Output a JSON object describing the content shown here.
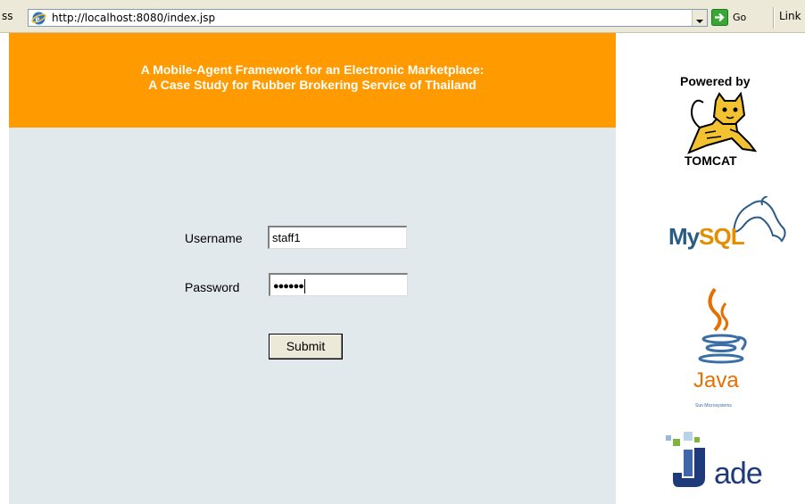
{
  "browser": {
    "address_label": "ss",
    "url": "http://localhost:8080/index.jsp",
    "go_label": "Go",
    "links_label": "Link"
  },
  "header": {
    "title_line1": "A Mobile-Agent Framework for an Electronic Marketplace:",
    "title_line2": "A Case Study for Rubber Brokering Service of Thailand"
  },
  "form": {
    "username_label": "Username",
    "username_value": "staff1",
    "password_label": "Password",
    "password_masked": "●●●●●●",
    "submit_label": "Submit"
  },
  "logos": {
    "powered_by": "Powered by",
    "tomcat": "TOMCAT",
    "mysql_my": "My",
    "mysql_sql": "SQL",
    "java": "Java",
    "sun": "Sun Microsystems",
    "jade": "ade"
  },
  "colors": {
    "header_bg": "#ff9a00",
    "main_bg": "#e2e9ec",
    "mysql_blue": "#2a5b85",
    "mysql_orange": "#e48e00",
    "java_orange": "#e76f00",
    "jade_blue": "#1f3a7a"
  }
}
